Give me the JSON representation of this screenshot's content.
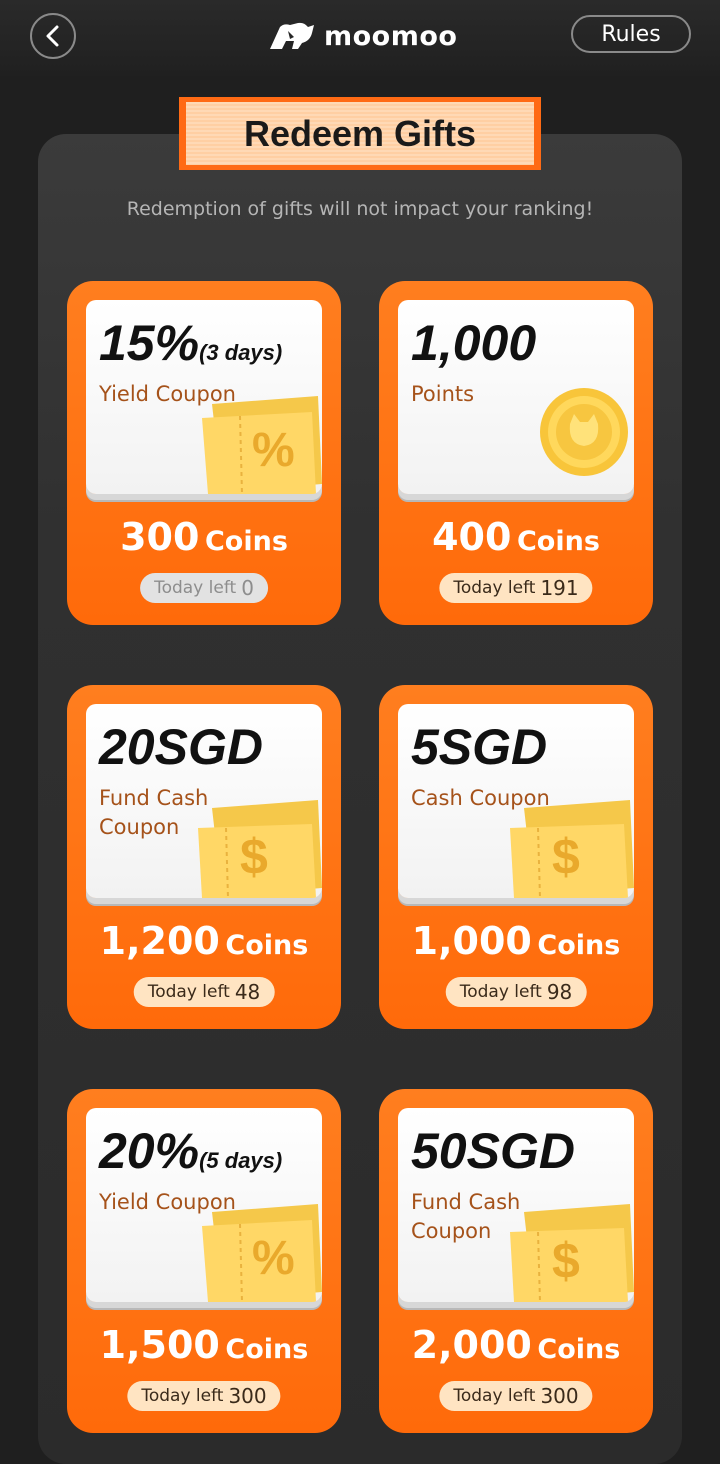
{
  "header": {
    "logo_text": "moomoo",
    "rules_label": "Rules"
  },
  "banner": {
    "title": "Redeem Gifts",
    "subtitle": "Redemption of gifts will not impact your ranking!"
  },
  "gifts": [
    {
      "big": "15%",
      "big_suffix": "(3 days)",
      "desc": "Yield Coupon",
      "coins": "300",
      "coins_unit": "Coins",
      "left_label": "Today left",
      "left_count": "0"
    },
    {
      "big": "1,000",
      "big_suffix": "",
      "desc": "Points",
      "coins": "400",
      "coins_unit": "Coins",
      "left_label": "Today left",
      "left_count": "191"
    },
    {
      "big": "20SGD",
      "big_suffix": "",
      "desc": "Fund Cash Coupon",
      "coins": "1,200",
      "coins_unit": "Coins",
      "left_label": "Today left",
      "left_count": "48"
    },
    {
      "big": "5SGD",
      "big_suffix": "",
      "desc": "Cash Coupon",
      "coins": "1,000",
      "coins_unit": "Coins",
      "left_label": "Today left",
      "left_count": "98"
    },
    {
      "big": "20%",
      "big_suffix": "(5 days)",
      "desc": "Yield Coupon",
      "coins": "1,500",
      "coins_unit": "Coins",
      "left_label": "Today left",
      "left_count": "300"
    },
    {
      "big": "50SGD",
      "big_suffix": "",
      "desc": "Fund Cash Coupon",
      "coins": "2,000",
      "coins_unit": "Coins",
      "left_label": "Today left",
      "left_count": "300"
    }
  ],
  "icons": [
    "chevron-left-icon",
    "moomoo-bull-logo",
    "percent-ticket-icon",
    "gold-coin-icon",
    "dollar-ticket-icon"
  ]
}
